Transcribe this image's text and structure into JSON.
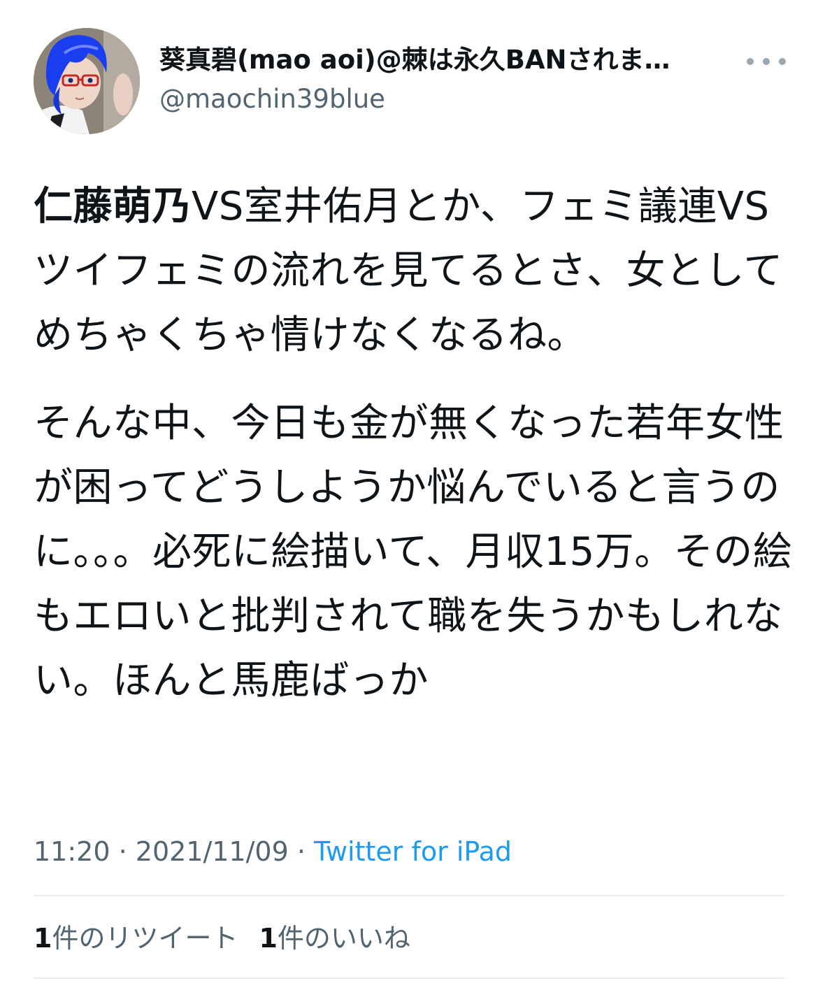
{
  "author": {
    "display_name": "葵真碧(mao aoi)@棘は永久BANされま…",
    "handle": "@maochin39blue"
  },
  "tweet": {
    "bold_prefix": "仁藤萌乃",
    "para1_rest": "VS室井佑月とか、フェミ議連VSツイフェミの流れを見てるとさ、女としてめちゃくちゃ情けなくなるね。",
    "para2": "そんな中、今日も金が無くなった若年女性が困ってどうしようか悩んでいると言うのに。。。必死に絵描いて、月収15万。その絵もエロいと批判されて職を失うかもしれない。ほんと馬鹿ばっか"
  },
  "meta": {
    "time": "11:20",
    "separator": " · ",
    "date": "2021/11/09",
    "source": "Twitter for iPad"
  },
  "stats": {
    "retweet_count": "1",
    "retweet_label": "件のリツイート",
    "like_count": "1",
    "like_label": "件のいいね"
  },
  "icons": {
    "more": "more-horizontal-icon",
    "avatar": "avatar-image"
  },
  "colors": {
    "link": "#1d9bf0",
    "secondary_text": "#536471",
    "primary_text": "#0f1419"
  }
}
